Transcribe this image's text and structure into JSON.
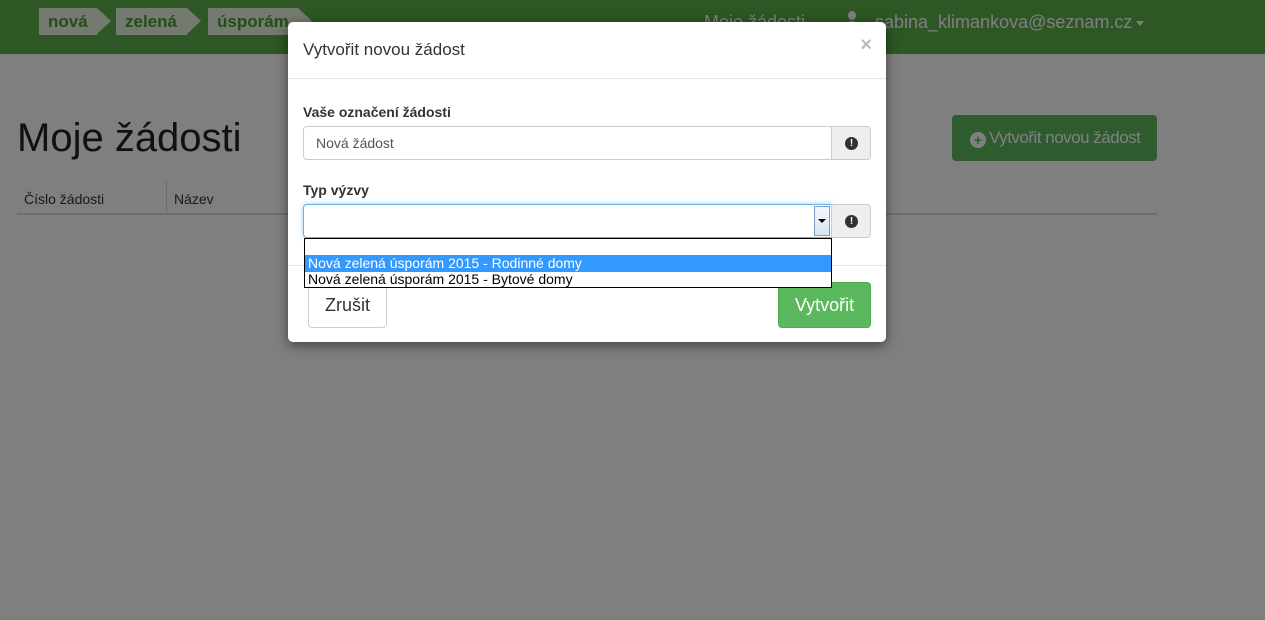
{
  "navbar": {
    "logo": [
      "nová",
      "zelená",
      "úsporám"
    ],
    "links": {
      "my_requests": "Moje žádosti"
    },
    "user_email": "sabina_klimankova@seznam.cz"
  },
  "page": {
    "title": "Moje žádosti",
    "new_request_button": "Vytvořit novou žádost",
    "table_headers": [
      "Číslo žádosti",
      "Název"
    ]
  },
  "modal": {
    "title": "Vytvořit novou žádost",
    "close_symbol": "×",
    "fields": {
      "label_name": "Vaše označení žádosti",
      "name_value": "Nová žádost",
      "label_type": "Typ výzvy",
      "type_value": ""
    },
    "dropdown_options": [
      "",
      "Nová zelená úsporám 2015 - Rodinné domy",
      "Nová zelená úsporám 2015 - Bytové domy"
    ],
    "selected_option_index": 1,
    "buttons": {
      "cancel": "Zrušit",
      "create": "Vytvořit"
    }
  },
  "colors": {
    "navbar": "#5cae4a",
    "primary_green": "#5cb85c",
    "dropdown_highlight": "#3399ff"
  }
}
